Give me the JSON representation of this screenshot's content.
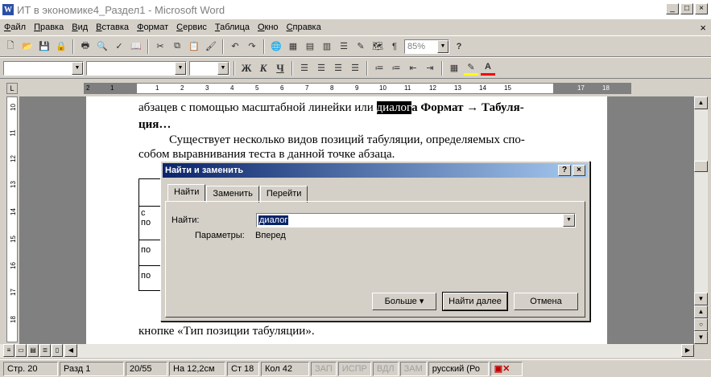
{
  "window": {
    "title": "ИТ в экономике4_Раздел1 - Microsoft Word",
    "controls": [
      "_",
      "□",
      "×"
    ]
  },
  "menu": [
    "Файл",
    "Правка",
    "Вид",
    "Вставка",
    "Формат",
    "Сервис",
    "Таблица",
    "Окно",
    "Справка"
  ],
  "menu_close": "×",
  "toolbar_std": {
    "zoom": "85%",
    "icons": [
      "new-icon",
      "open-icon",
      "save-icon",
      "permission-icon",
      "print-icon",
      "print-preview-icon",
      "spelling-icon",
      "research-icon",
      "cut-icon",
      "copy-icon",
      "paste-icon",
      "format-painter-icon",
      "undo-icon",
      "redo-icon",
      "hyperlink-icon",
      "tables-borders-icon",
      "insert-table-icon",
      "insert-excel-icon",
      "columns-icon",
      "drawing-icon",
      "document-map-icon",
      "show-formatting-icon",
      "help-icon"
    ]
  },
  "toolbar_fmt": {
    "style": "",
    "font": "",
    "size": "",
    "bold": "Ж",
    "italic": "К",
    "underline": "Ч"
  },
  "ruler": {
    "numbers": [
      "2",
      "1",
      "1",
      "2",
      "3",
      "4",
      "5",
      "6",
      "7",
      "8",
      "9",
      "10",
      "11",
      "12",
      "13",
      "14",
      "15",
      "17",
      "18"
    ]
  },
  "vruler": {
    "numbers": [
      "10",
      "11",
      "12",
      "13",
      "14",
      "15",
      "16",
      "17",
      "18"
    ]
  },
  "document": {
    "line1": "абзацев с помощью масштабной линейки или ",
    "line1_hl": "диалог",
    "line1_rest": "а Формат → Табуля-",
    "line2": "ция…",
    "line3": "Существует несколько видов позиций табуляции, определяемых спо-",
    "line4": "собом выравнивания теста в данной точке абзаца.",
    "table_cells": [
      "с",
      "по",
      "по",
      "по"
    ],
    "bottom_line": "кнопке «Тип позиции табуляции»."
  },
  "status": {
    "page": "Стр. 20",
    "section": "Разд 1",
    "pages": "20/55",
    "at": "На 12,2см",
    "line": "Ст 18",
    "col": "Кол 42",
    "rec": "ЗАП",
    "trk": "ИСПР",
    "ext": "ВДЛ",
    "ovr": "ЗАМ",
    "lang": "русский (Ро"
  },
  "dialog": {
    "title": "Найти и заменить",
    "help_btn": "?",
    "close_btn": "×",
    "tabs": [
      "Найти",
      "Заменить",
      "Перейти"
    ],
    "find_label": "Найти:",
    "find_value": "диалог",
    "params_label": "Параметры:",
    "params_value": "Вперед",
    "more_button": "Больше ▾",
    "find_next_button": "Найти далее",
    "cancel_button": "Отмена"
  }
}
